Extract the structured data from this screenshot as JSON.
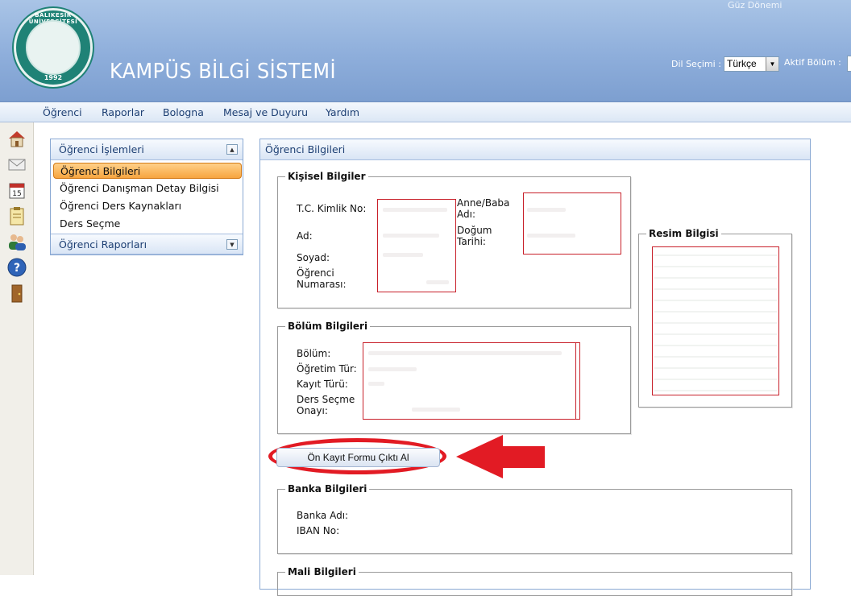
{
  "header": {
    "term": "Güz Dönemi",
    "site_title": "KAMPÜS BİLGİ SİSTEMİ",
    "logo_text": "BALIKESİR ÜNİVERSİTESİ",
    "logo_year": "1992",
    "language_label": "Dil Seçimi :",
    "language_value": "Türkçe",
    "department_label": "Aktif Bölüm :"
  },
  "menu": [
    "Öğrenci",
    "Raporlar",
    "Bologna",
    "Mesaj ve Duyuru",
    "Yardım"
  ],
  "iconbar": [
    "home-icon",
    "mail-icon",
    "calendar-icon",
    "clipboard-icon",
    "users-icon",
    "help-icon",
    "exit-door-icon"
  ],
  "calendar_day": "15",
  "left_panel": {
    "section1_title": "Öğrenci İşlemleri",
    "items": [
      "Öğrenci Bilgileri",
      "Öğrenci Danışman Detay Bilgisi",
      "Öğrenci Ders Kaynakları",
      "Ders Seçme"
    ],
    "section2_title": "Öğrenci Raporları"
  },
  "main": {
    "title": "Öğrenci Bilgileri",
    "personal": {
      "legend": "Kişisel Bilgiler",
      "tc_label": "T.C. Kimlik No:",
      "name_label": "Ad:",
      "surname_label": "Soyad:",
      "student_no_label": "Öğrenci Numarası:",
      "parent_label": "Anne/Baba Adı:",
      "birth_label": "Doğum Tarihi:"
    },
    "photo": {
      "legend": "Resim Bilgisi"
    },
    "department": {
      "legend": "Bölüm Bilgileri",
      "dept_label": "Bölüm:",
      "edu_type_label": "Öğretim Tür:",
      "reg_type_label": "Kayıt Türü:",
      "approval_label": "Ders Seçme Onayı:"
    },
    "print_button": "Ön Kayıt Formu Çıktı Al",
    "bank": {
      "legend": "Banka Bilgileri",
      "bank_name_label": "Banka Adı:",
      "iban_label": "IBAN No:"
    },
    "next_legend": "Mali Bilgileri"
  },
  "colors": {
    "header_blue": "#8eaedb",
    "menu_text": "#1d3f73",
    "highlight_red": "#e21b24",
    "active_item_orange": "#f7a540"
  }
}
